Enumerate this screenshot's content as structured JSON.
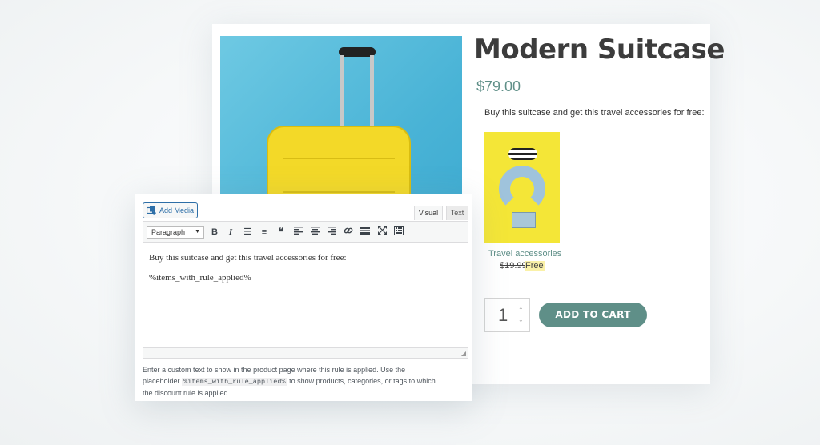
{
  "product": {
    "title": "Modern Suitcase",
    "price": "$79.00",
    "promo_text": "Buy this suitcase and get this travel accessories for free:",
    "accessory": {
      "name": "Travel accessories",
      "old_price": "$19.99",
      "new_price": "Free"
    },
    "quantity": "1",
    "add_to_cart_label": "ADD TO CART",
    "brand_color": "#5f8f88"
  },
  "editor": {
    "add_media_label": "Add Media",
    "tabs": {
      "visual": "Visual",
      "text": "Text"
    },
    "format_select": "Paragraph",
    "toolbar_icons": [
      "bold-icon",
      "italic-icon",
      "bullet-list-icon",
      "numbered-list-icon",
      "blockquote-icon",
      "align-left-icon",
      "align-center-icon",
      "align-right-icon",
      "link-icon",
      "read-more-icon",
      "fullscreen-icon",
      "toolbar-toggle-icon"
    ],
    "content_line1": "Buy this suitcase and get this travel accessories for free:",
    "content_line2": "%items_with_rule_applied%",
    "help_before": "Enter a custom text to show in the product page where this rule is applied. Use the placeholder",
    "help_code": "%items_with_rule_applied%",
    "help_after": "to show products, categories, or tags to which the discount rule is applied."
  }
}
